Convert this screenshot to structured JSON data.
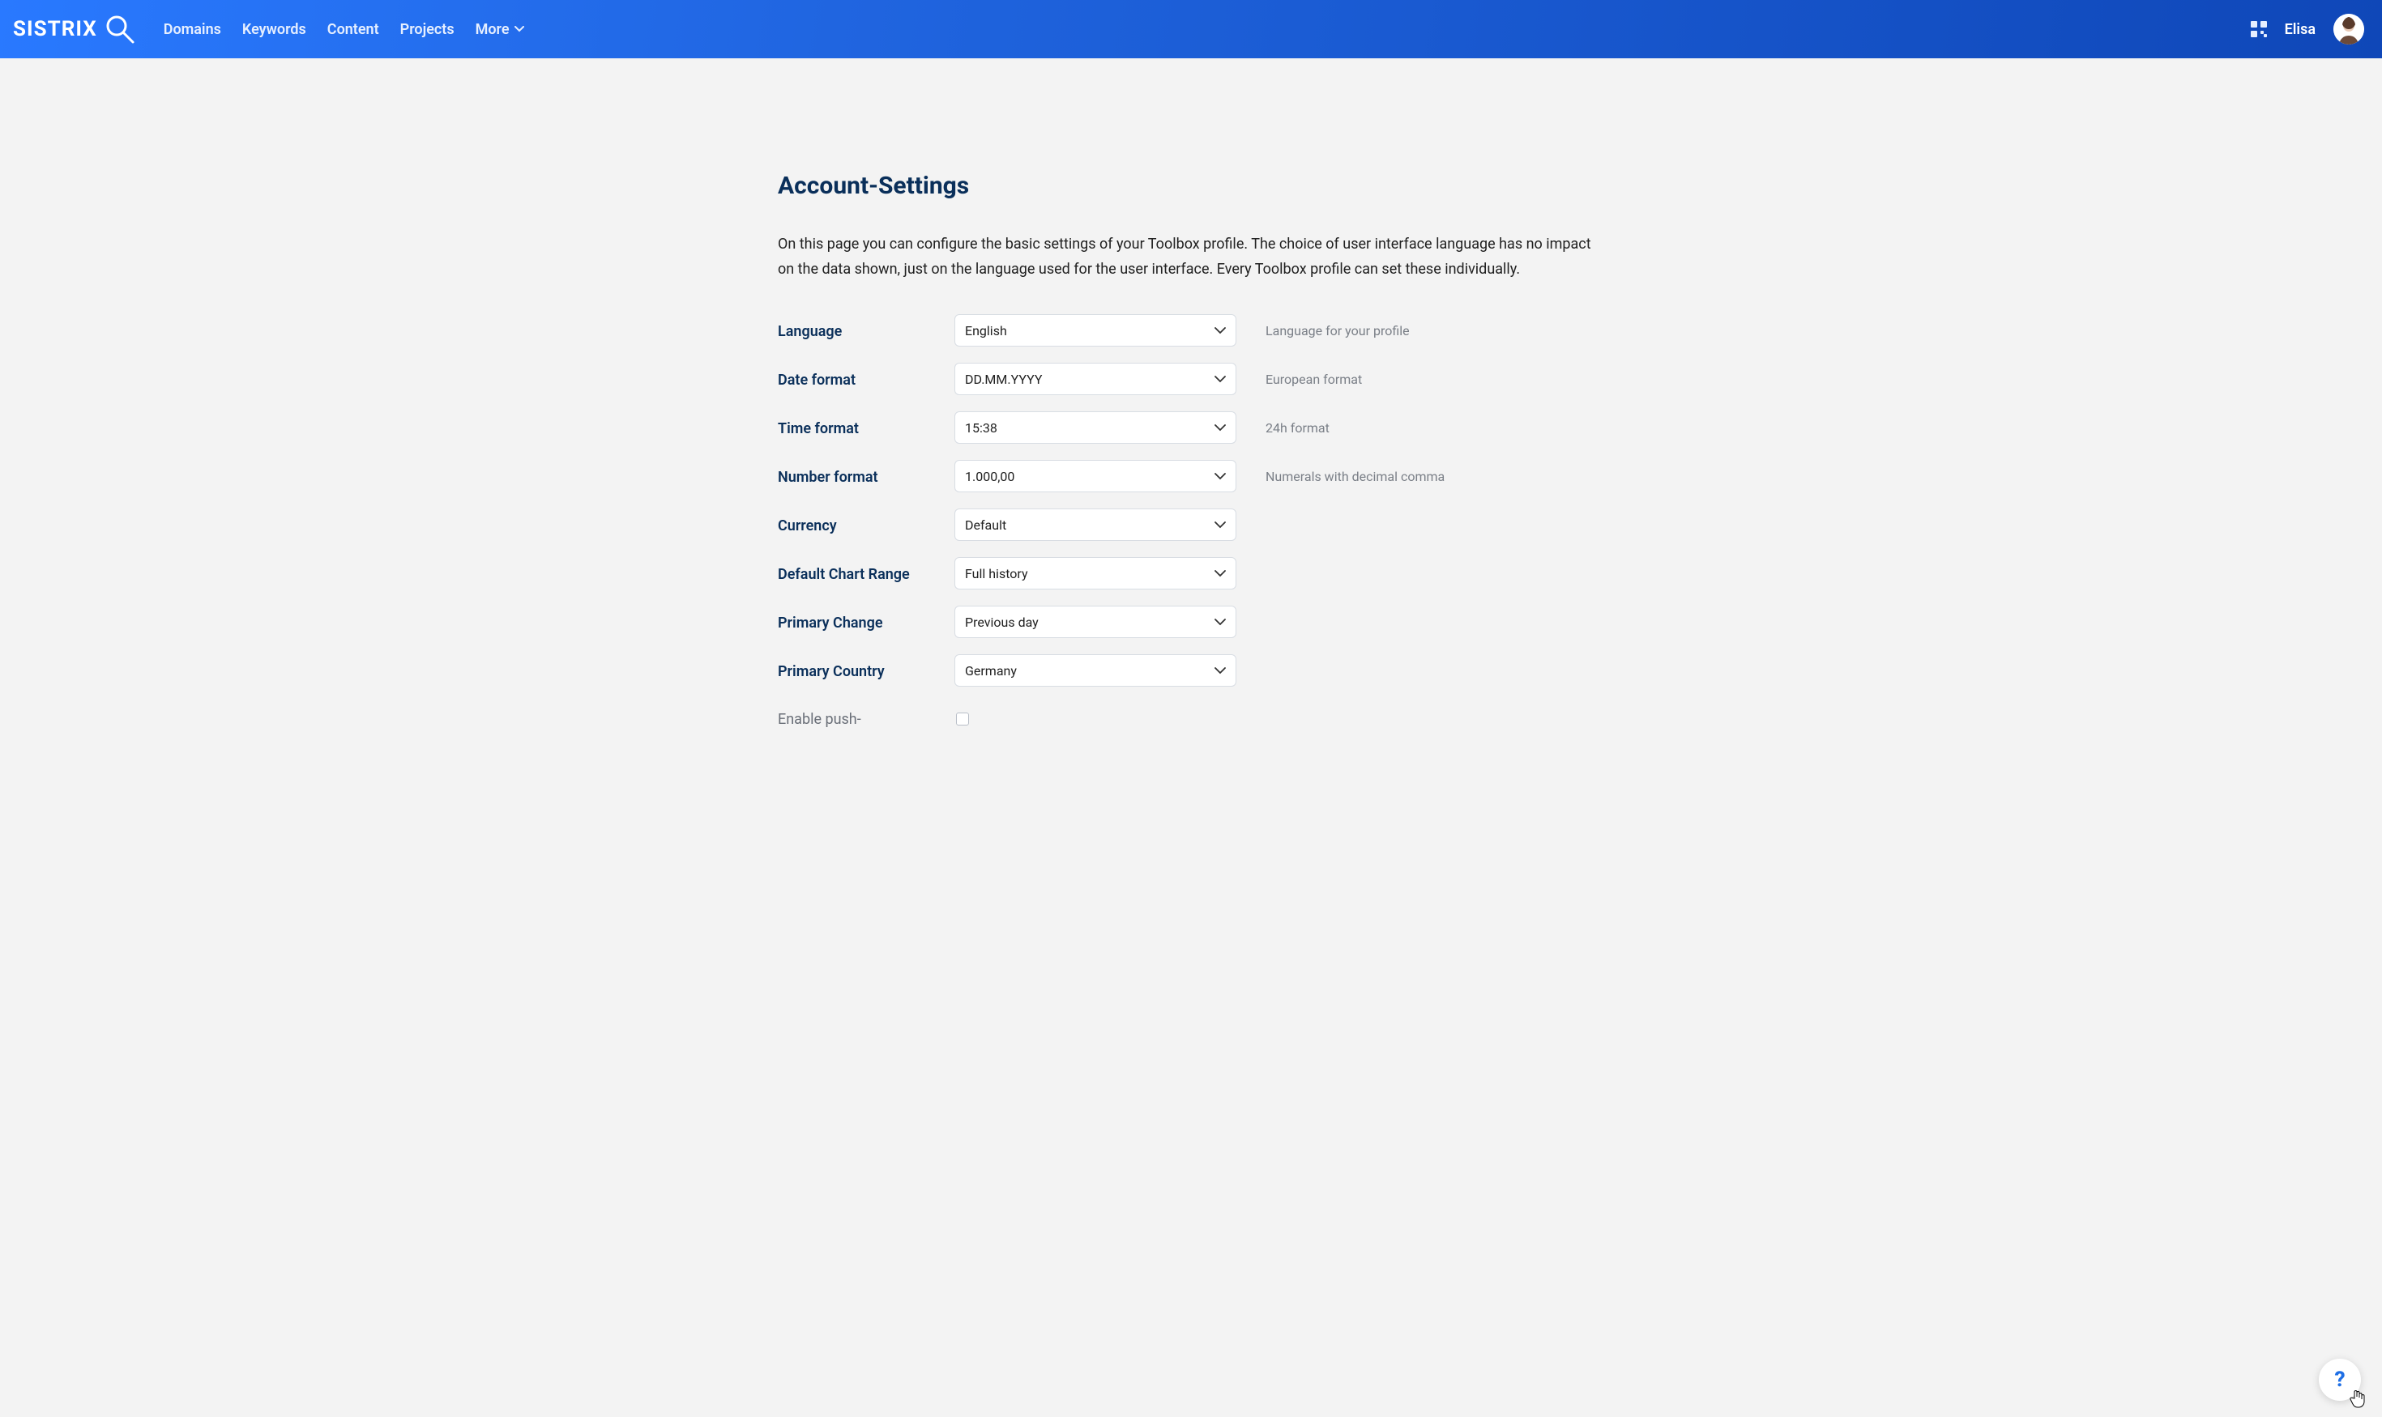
{
  "header": {
    "logo_text": "SISTRIX",
    "nav": {
      "domains": "Domains",
      "keywords": "Keywords",
      "content": "Content",
      "projects": "Projects",
      "more": "More"
    },
    "username": "Elisa"
  },
  "page": {
    "title": "Account-Settings",
    "description": "On this page you can configure the basic settings of your Toolbox profile. The choice of user interface language has no impact on the data shown, just on the language used for the user interface. Every Toolbox profile can set these individually."
  },
  "rows": {
    "language": {
      "label": "Language",
      "value": "English",
      "hint": "Language for your profile"
    },
    "date_format": {
      "label": "Date format",
      "value": "DD.MM.YYYY",
      "hint": "European format"
    },
    "time_format": {
      "label": "Time format",
      "value": "15:38",
      "hint": "24h format"
    },
    "number_format": {
      "label": "Number format",
      "value": "1.000,00",
      "hint": "Numerals with decimal comma"
    },
    "currency": {
      "label": "Currency",
      "value": "Default",
      "hint": ""
    },
    "chart_range": {
      "label": "Default Chart Range",
      "value": "Full history",
      "hint": ""
    },
    "primary_change": {
      "label": "Primary Change",
      "value": "Previous day",
      "hint": ""
    },
    "primary_country": {
      "label": "Primary Country",
      "value": "Germany",
      "hint": ""
    },
    "enable_push": {
      "label": "Enable push-"
    }
  },
  "help": {
    "glyph": "?"
  }
}
